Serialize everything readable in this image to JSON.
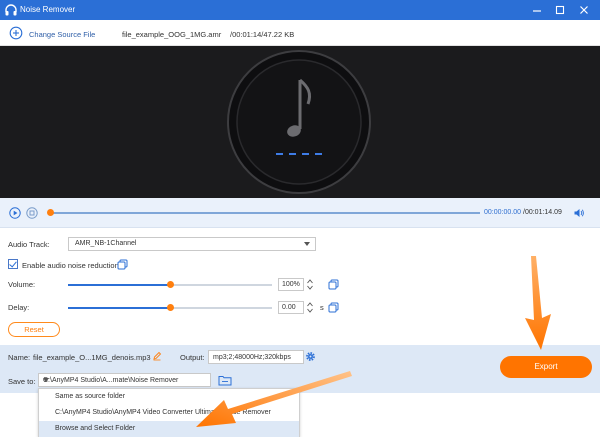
{
  "window": {
    "title": "Noise Remover",
    "controls": [
      "minimize-icon",
      "maximize-icon",
      "close-icon"
    ]
  },
  "file_bar": {
    "change_source_label": "Change Source File",
    "file_name": "file_example_OOG_1MG.amr",
    "file_info": "/00:01:14/47.22 KB"
  },
  "preview": {
    "icon": "music-note-icon"
  },
  "player": {
    "current_time": "00:00:00.00",
    "total_time": "/00:01:14.09",
    "progress": 0
  },
  "settings": {
    "audio_track_label": "Audio Track:",
    "audio_track_value": "AMR_NB-1Channel",
    "enable_noise_label": "Enable audio noise reduction",
    "enable_noise_checked": true,
    "volume_label": "Volume:",
    "volume_value": "100%",
    "volume_fraction": 0.5,
    "delay_label": "Delay:",
    "delay_value": "0.00",
    "delay_unit": "s",
    "delay_fraction": 0.5,
    "reset_label": "Reset"
  },
  "output": {
    "name_label": "Name:",
    "name_value": "file_example_O...1MG_denois.mp3",
    "output_label": "Output:",
    "output_value": "mp3;2;48000Hz;320kbps",
    "save_to_label": "Save to:",
    "save_to_value": "C:\\AnyMP4 Studio\\A...mate\\Noise Remover",
    "export_label": "Export"
  },
  "save_dropdown": {
    "items": [
      "Same as source folder",
      "C:\\AnyMP4 Studio\\AnyMP4 Video Converter Ultimate\\Noise Remover",
      "Browse and Select Folder"
    ],
    "highlighted_index": 2
  },
  "colors": {
    "titlebar": "#2b6fd6",
    "accent_orange": "#ff7400",
    "accent_blue": "#2b6fd6",
    "preview_bg": "#1b1b1d"
  }
}
